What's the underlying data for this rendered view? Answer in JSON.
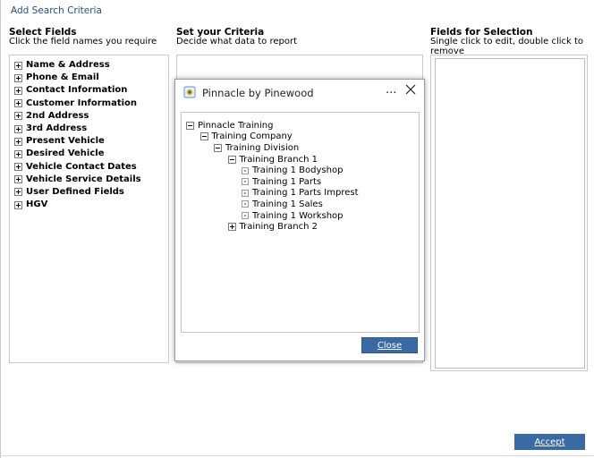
{
  "header": {
    "add_search_criteria": "Add Search Criteria"
  },
  "columns": {
    "select_fields": {
      "title": "Select Fields",
      "subtitle": "Click the field names you require"
    },
    "set_criteria": {
      "title": "Set your Criteria",
      "subtitle": "Decide what data to report"
    },
    "fields_for_selection": {
      "title": "Fields for Selection",
      "subtitle": "Single click to edit, double click to remove"
    }
  },
  "fields": [
    "Name & Address",
    "Phone & Email",
    "Contact Information",
    "Customer Information",
    "2nd Address",
    "3rd Address",
    "Present Vehicle",
    "Desired Vehicle",
    "Vehicle Contact Dates",
    "Vehicle Service Details",
    "User Defined Fields",
    "HGV"
  ],
  "accept_label": "Accept",
  "modal": {
    "title": "Pinnacle by Pinewood",
    "more": "...",
    "close_label": "Close",
    "tree": [
      {
        "label": "Pinnacle Training",
        "state": "expanded"
      },
      {
        "label": "Training Company",
        "state": "expanded"
      },
      {
        "label": "Training Division",
        "state": "expanded"
      },
      {
        "label": "Training Branch 1",
        "state": "expanded"
      },
      {
        "label": "Training 1 Bodyshop",
        "state": "leaf"
      },
      {
        "label": "Training 1 Parts",
        "state": "leaf"
      },
      {
        "label": "Training 1 Parts Imprest",
        "state": "leaf"
      },
      {
        "label": "Training 1 Sales",
        "state": "leaf"
      },
      {
        "label": "Training 1 Workshop",
        "state": "leaf"
      },
      {
        "label": "Training Branch 2",
        "state": "collapsed"
      }
    ]
  }
}
